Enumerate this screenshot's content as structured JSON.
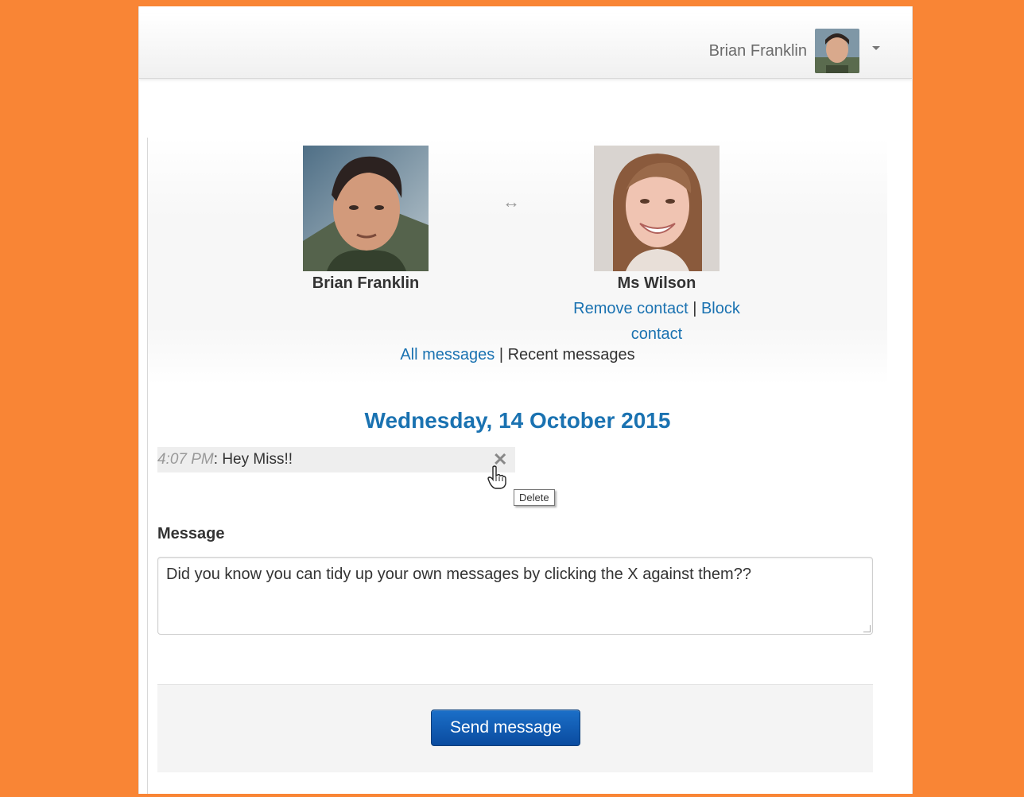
{
  "header": {
    "user_name": "Brian Franklin"
  },
  "contacts": {
    "self_name": "Brian Franklin",
    "other_name": "Ms Wilson",
    "swap_icon": "↔",
    "remove_link": "Remove contact",
    "separator": "|",
    "block_link": "Block",
    "block_link_2": "contact"
  },
  "nav": {
    "all_messages": "All messages",
    "separator": "|",
    "recent_messages": "Recent messages"
  },
  "conversation": {
    "date_heading": "Wednesday, 14 October 2015",
    "messages": [
      {
        "time": "4:07 PM",
        "separator": ": ",
        "text": "Hey Miss!!"
      }
    ],
    "delete_icon": "✕",
    "delete_tooltip": "Delete"
  },
  "composer": {
    "label": "Message",
    "value": "Did you know you can tidy up your own messages by clicking the X against them??",
    "send_label": "Send message"
  },
  "colors": {
    "background": "#f98535",
    "link": "#1a72b1",
    "button": "#0a4b9f"
  }
}
